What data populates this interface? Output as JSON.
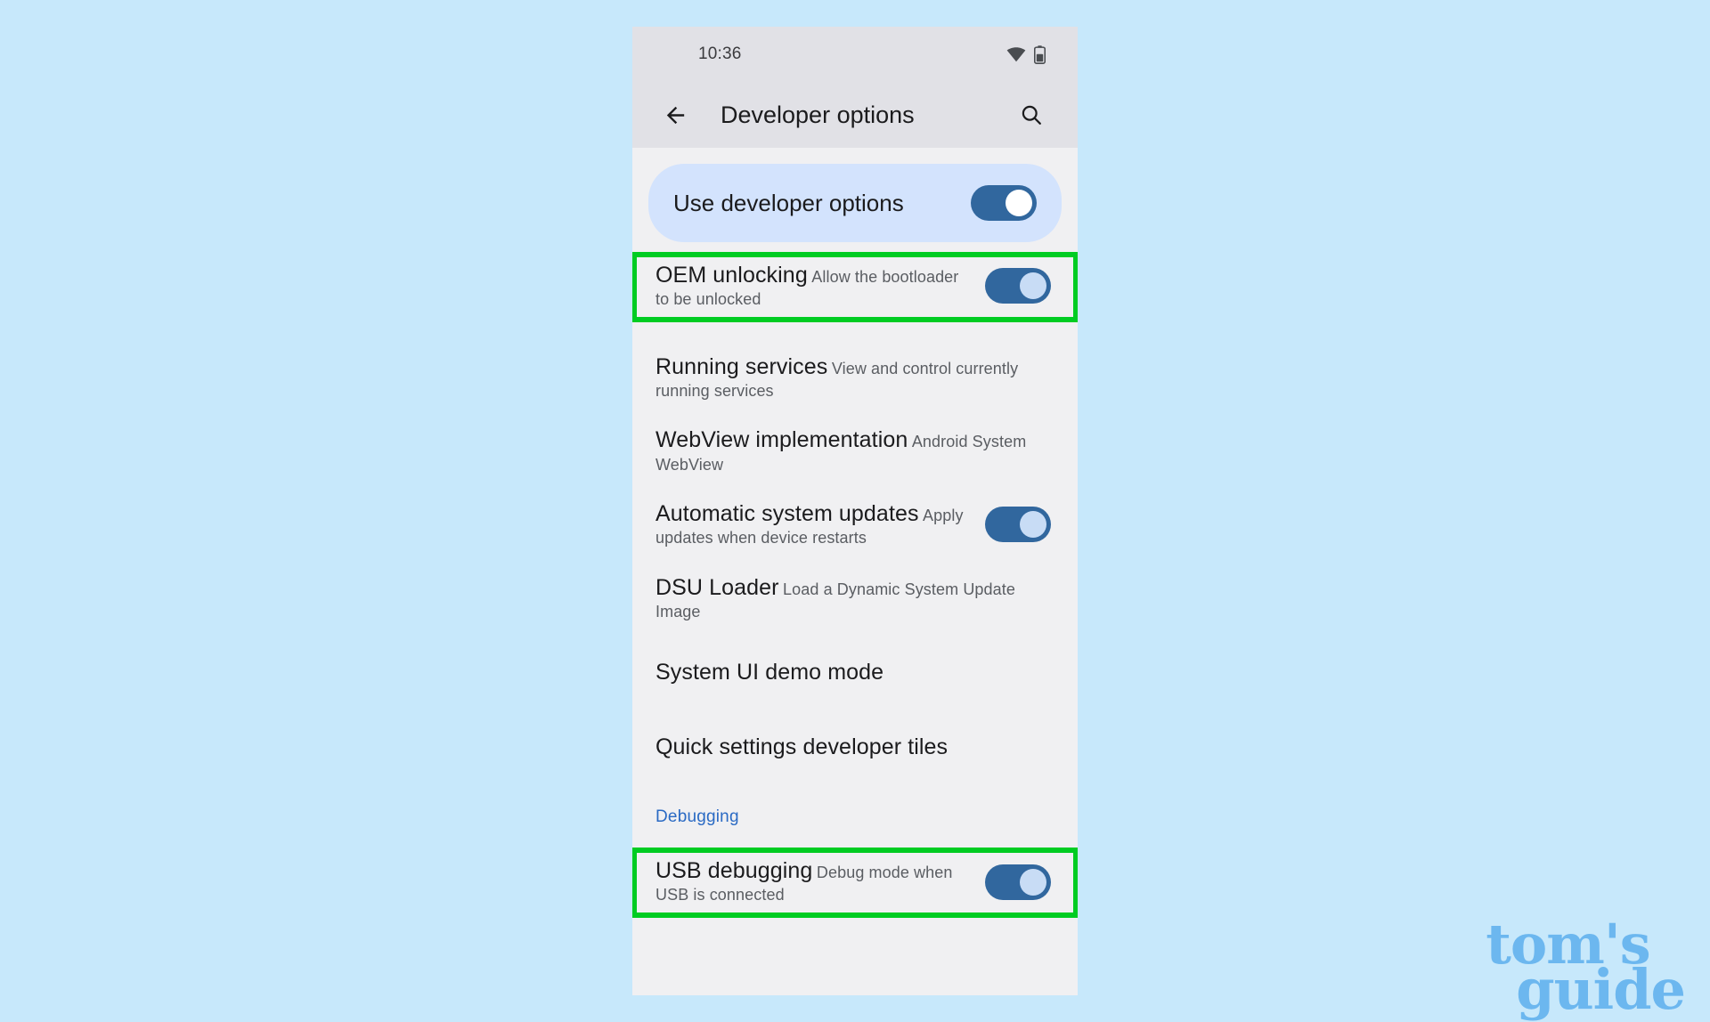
{
  "page": {
    "background_color": "#c7e8fb",
    "watermark_line1": "tom's",
    "watermark_line2": "guide",
    "watermark_color": "#6cb7ef"
  },
  "statusbar": {
    "time": "10:36",
    "wifi_icon": "wifi-icon",
    "battery_icon": "battery-icon"
  },
  "appbar": {
    "back_icon": "back-arrow-icon",
    "title": "Developer options",
    "search_icon": "search-icon"
  },
  "master_toggle": {
    "label": "Use developer options",
    "state": "on",
    "card_color": "#d3e3fd",
    "track_color": "#31679e"
  },
  "highlight_color": "#00cc22",
  "rows": [
    {
      "title": "OEM unlocking",
      "subtitle": "Allow the bootloader to be unlocked",
      "toggle": "on",
      "highlighted": true
    },
    {
      "title": "Running services",
      "subtitle": "View and control currently running services",
      "toggle": null,
      "highlighted": false
    },
    {
      "title": "WebView implementation",
      "subtitle": "Android System WebView",
      "toggle": null,
      "highlighted": false
    },
    {
      "title": "Automatic system updates",
      "subtitle": "Apply updates when device restarts",
      "toggle": "on",
      "highlighted": false
    },
    {
      "title": "DSU Loader",
      "subtitle": "Load a Dynamic System Update Image",
      "toggle": null,
      "highlighted": false
    },
    {
      "title": "System UI demo mode",
      "subtitle": "",
      "toggle": null,
      "highlighted": false
    },
    {
      "title": "Quick settings developer tiles",
      "subtitle": "",
      "toggle": null,
      "highlighted": false
    }
  ],
  "section": {
    "debugging_label": "Debugging",
    "debugging_color": "#2a6ac4"
  },
  "debug_rows": [
    {
      "title": "USB debugging",
      "subtitle": "Debug mode when USB is connected",
      "toggle": "on",
      "highlighted": true
    }
  ]
}
